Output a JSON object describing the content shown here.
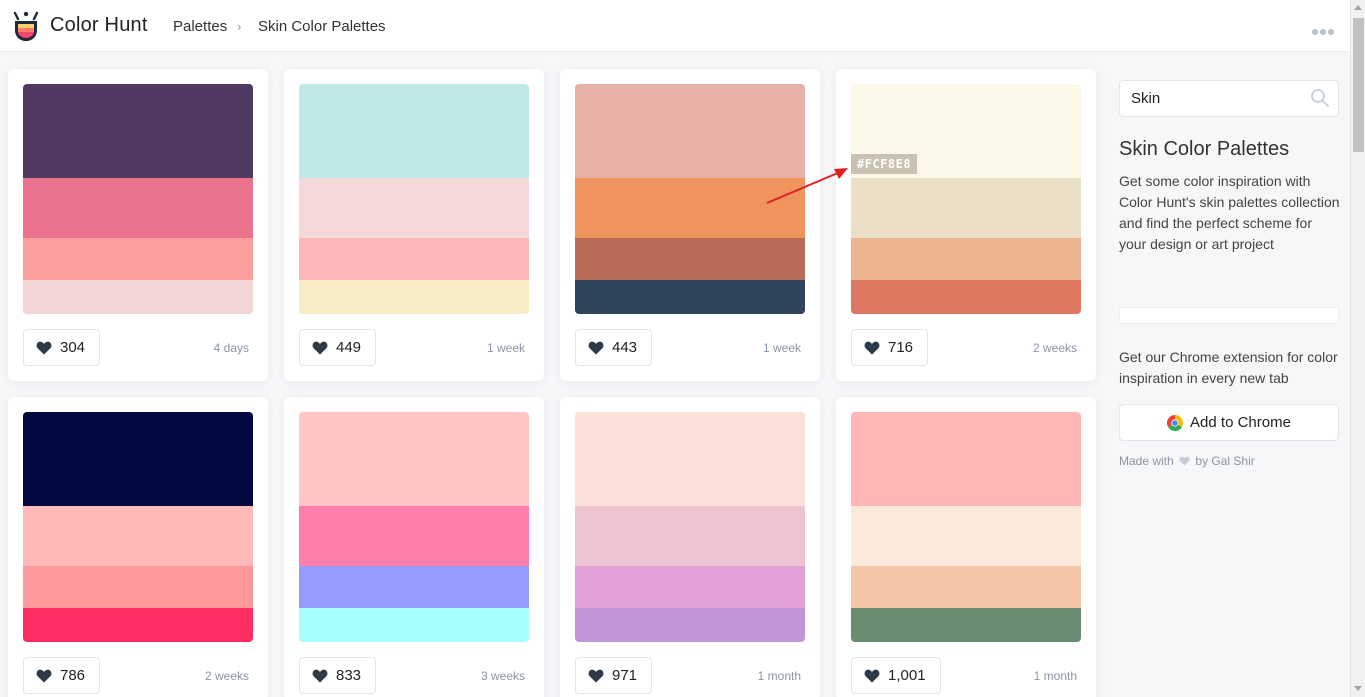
{
  "header": {
    "brand": "Color Hunt",
    "breadcrumb": [
      "Palettes",
      "Skin Color Palettes"
    ],
    "breadcrumb_separator": "›"
  },
  "palettes": [
    {
      "colors": [
        "#4f3961",
        "#ea728c",
        "#fc9d9d",
        "#f3d4d4"
      ],
      "likes": "304",
      "age": "4 days"
    },
    {
      "colors": [
        "#bfe9e8",
        "#f5d9da",
        "#fdb7b9",
        "#f6edc6"
      ],
      "likes": "449",
      "age": "1 week"
    },
    {
      "colors": [
        "#e5b1a7",
        "#f0945d",
        "#b86b57",
        "#2f455c"
      ],
      "likes": "443",
      "age": "1 week"
    },
    {
      "colors": [
        "#fcf8e8",
        "#ecdfc8",
        "#ecb390",
        "#df7861"
      ],
      "likes": "716",
      "age": "2 weeks",
      "hover_hex": "#FCF8E8"
    },
    {
      "colors": [
        "#020842",
        "#ffb9b9",
        "#ff9a9a",
        "#ff2e63"
      ],
      "likes": "786",
      "age": "2 weeks"
    },
    {
      "colors": [
        "#ffc5c5",
        "#ff7eac",
        "#969bff",
        "#a6fffa"
      ],
      "likes": "833",
      "age": "3 weeks"
    },
    {
      "colors": [
        "#fbe0d8",
        "#edc3d1",
        "#e1a1d6",
        "#c296d6"
      ],
      "likes": "971",
      "age": "1 month"
    },
    {
      "colors": [
        "#ffb6b6",
        "#fde9db",
        "#f4c6a6",
        "#698b70"
      ],
      "likes": "1,001",
      "age": "1 month"
    }
  ],
  "sidebar": {
    "search_value": "Skin",
    "title": "Skin Color Palettes",
    "description": "Get some color inspiration with Color Hunt's skin palettes collection and find the perfect scheme for your design or art project",
    "extension_text": "Get our Chrome extension for color inspiration in every new tab",
    "chrome_button": "Add to Chrome",
    "made_with_prefix": "Made with",
    "made_with_suffix": "by Gal Shir"
  },
  "colors": {
    "annotation_arrow": "#e02020",
    "heart": "#2d3a48"
  }
}
